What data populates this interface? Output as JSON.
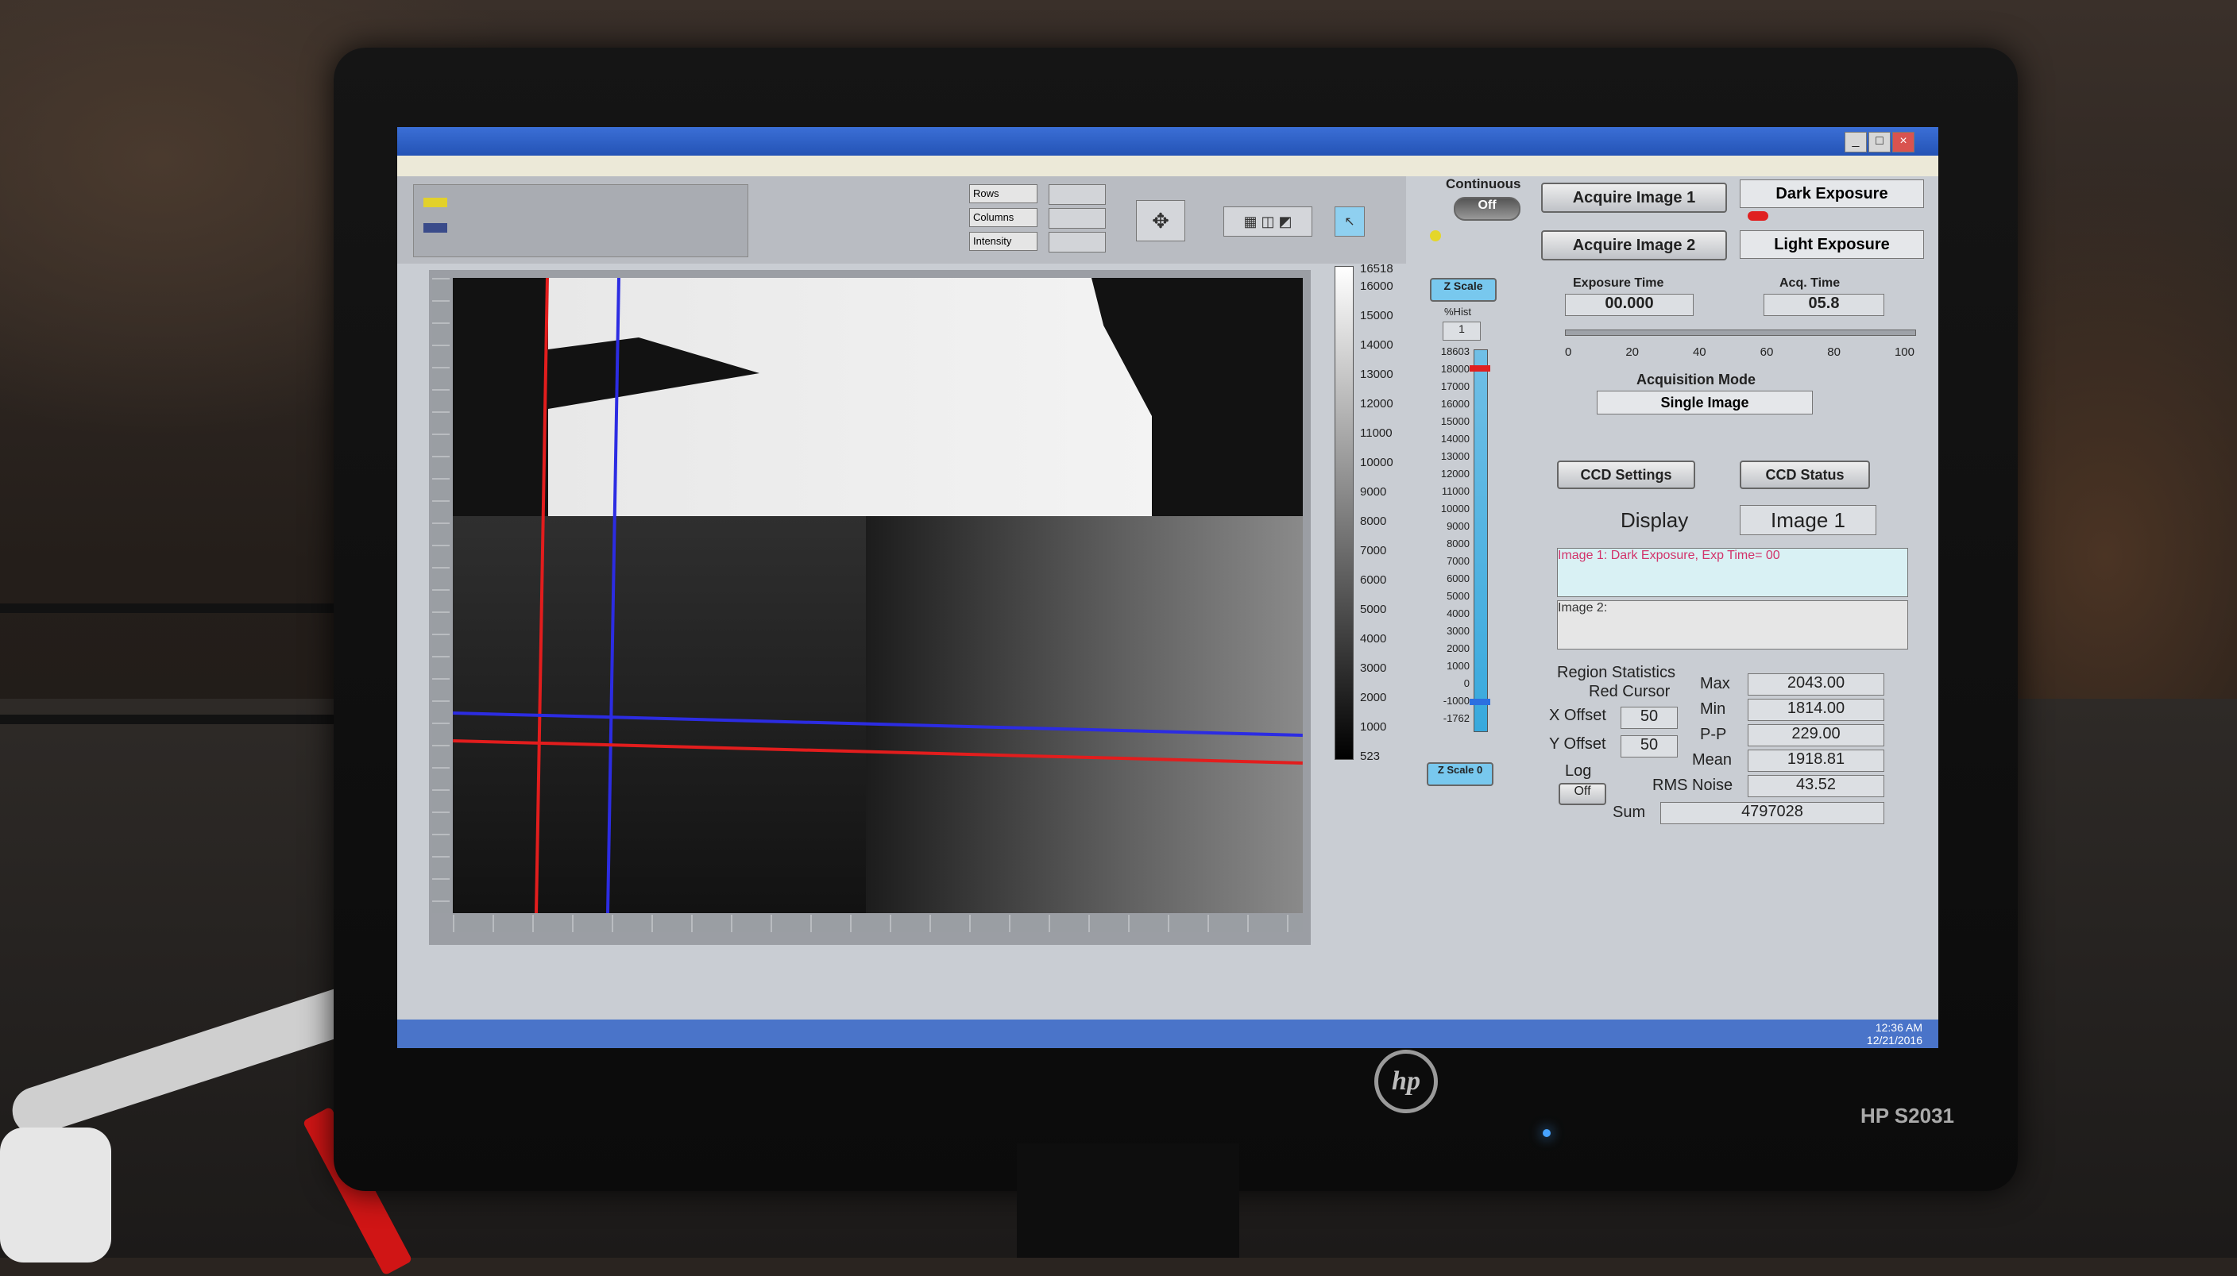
{
  "monitor": {
    "brand_logo": "hp",
    "model": "HP S2031"
  },
  "app": {
    "window_controls": [
      "_",
      "□",
      "×"
    ],
    "toolbar": {
      "rows_label": "Rows",
      "columns_label": "Columns",
      "intensity_label": "Intensity"
    },
    "colorbar": {
      "max_label": "16518",
      "ticks": [
        "16000",
        "15000",
        "14000",
        "13000",
        "12000",
        "11000",
        "10000",
        "9000",
        "8000",
        "7000",
        "6000",
        "5000",
        "4000",
        "3000",
        "2000",
        "1000"
      ],
      "min_label": "523"
    },
    "zscale": {
      "button": "Z Scale",
      "pct_hist_label": "%Hist",
      "pct_hist_value": "1",
      "ticks": [
        "18603",
        "18000",
        "17000",
        "16000",
        "15000",
        "14000",
        "13000",
        "12000",
        "11000",
        "10000",
        "9000",
        "8000",
        "7000",
        "6000",
        "5000",
        "4000",
        "3000",
        "2000",
        "1000",
        "0",
        "-1000",
        "-1762"
      ],
      "reset_button": "Z Scale 0"
    },
    "continuous": {
      "label": "Continuous",
      "value": "Off"
    },
    "acquire1": "Acquire Image 1",
    "acquire2": "Acquire Image 2",
    "dark_exposure": "Dark Exposure",
    "light_exposure": "Light Exposure",
    "exposure_time_label": "Exposure Time",
    "exposure_time_value": "00.000",
    "acq_time_label": "Acq. Time",
    "acq_time_value": "05.8",
    "progress": {
      "value_percent": 0,
      "ticks": [
        "0",
        "20",
        "40",
        "60",
        "80",
        "100"
      ]
    },
    "acq_mode_label": "Acquisition Mode",
    "acq_mode_value": "Single Image",
    "ccd_settings": "CCD Settings",
    "ccd_status": "CCD Status",
    "display_label": "Display",
    "display_value": "Image 1",
    "image1_msg": "Image 1: Dark Exposure, Exp Time= 00",
    "image2_msg": "Image 2:",
    "region_stats_label": "Region Statistics",
    "red_cursor_label": "Red Cursor",
    "x_offset_label": "X Offset",
    "x_offset_value": "50",
    "y_offset_label": "Y Offset",
    "y_offset_value": "50",
    "log_label": "Log",
    "log_value": "Off",
    "stats": {
      "max_label": "Max",
      "max": "2043.00",
      "min_label": "Min",
      "min": "1814.00",
      "pp_label": "P-P",
      "pp": "229.00",
      "mean_label": "Mean",
      "mean": "1918.81",
      "rms_label": "RMS Noise",
      "rms": "43.52",
      "sum_label": "Sum",
      "sum": "4797028"
    },
    "clock": {
      "time": "12:36 AM",
      "date": "12/21/2016"
    }
  }
}
